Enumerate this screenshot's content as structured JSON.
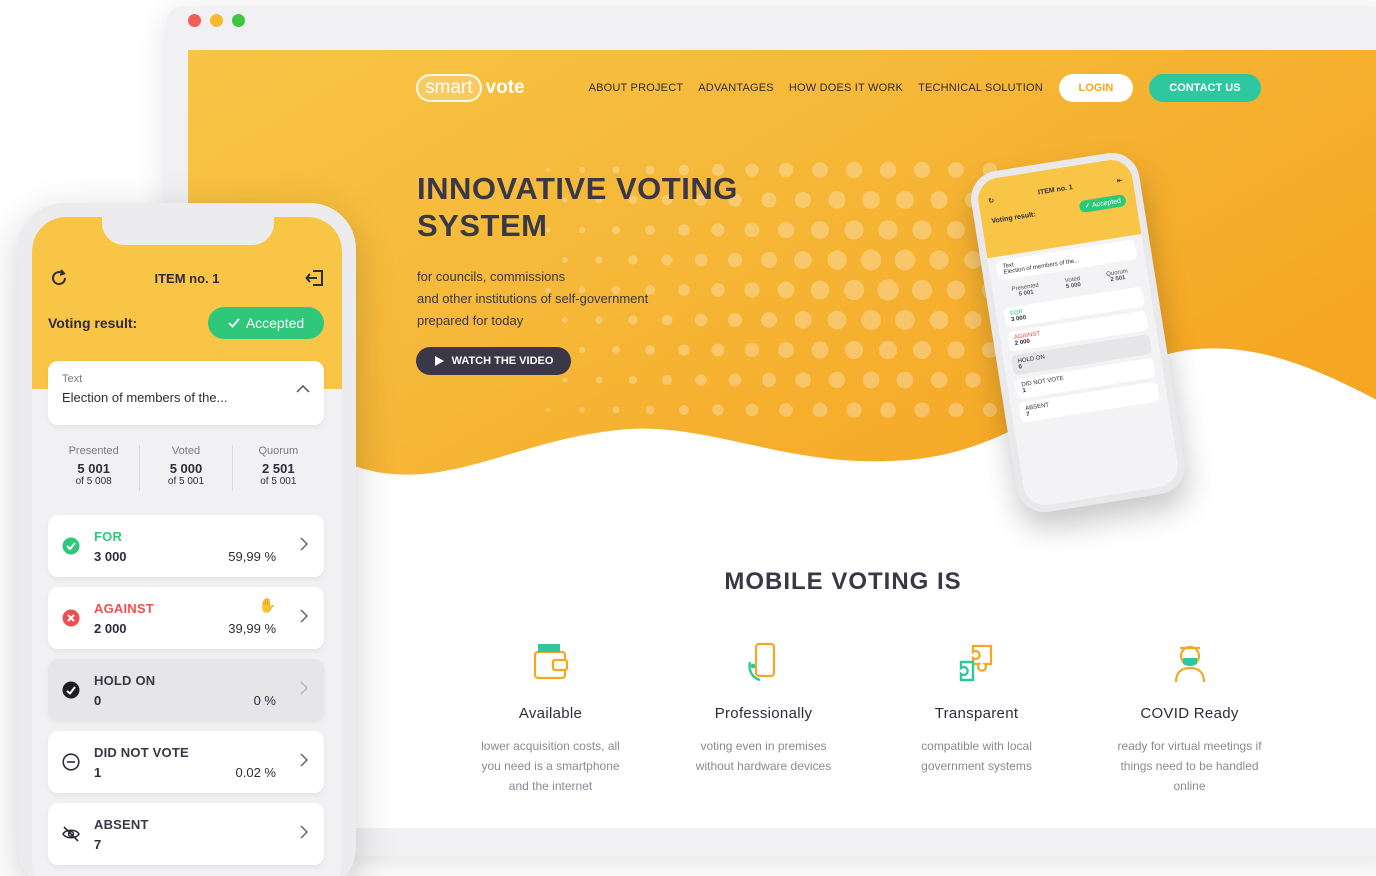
{
  "website": {
    "logo": {
      "part1": "smart",
      "part2": "vote"
    },
    "nav": [
      "ABOUT PROJECT",
      "ADVANTAGES",
      "HOW DOES IT WORK",
      "TECHNICAL SOLUTION"
    ],
    "login": "LOGIN",
    "contact": "CONTACT US",
    "hero": {
      "title": "INNOVATIVE VOTING SYSTEM",
      "subtitle": [
        "for councils, commissions",
        "and other institutions of self-government",
        "prepared for today"
      ],
      "video_button": "WATCH THE VIDEO"
    },
    "section_title": "MOBILE VOTING IS",
    "features": [
      {
        "title": "Available",
        "desc": "lower acquisition costs, all you need is a smartphone and the internet",
        "icon": "wallet-icon"
      },
      {
        "title": "Professionally",
        "desc": "voting even in premises without hardware devices",
        "icon": "phone-hand-icon"
      },
      {
        "title": "Transparent",
        "desc": "compatible with local government systems",
        "icon": "puzzle-icon"
      },
      {
        "title": "COVID Ready",
        "desc": "ready for virtual meetings if things need to be handled online",
        "icon": "masked-person-icon"
      }
    ],
    "colors": {
      "hero_yellow": "#f8c546",
      "hero_orange": "#f5a623",
      "accent_green": "#2fc7a0",
      "dark": "#3a3747"
    }
  },
  "phone": {
    "item_title": "ITEM no. 1",
    "voting_result_label": "Voting result:",
    "voting_result_value": "Accepted",
    "text_label": "Text",
    "text_value": "Election of members of the...",
    "stats": [
      {
        "label": "Presented",
        "value": "5 001",
        "of": "of 5 008"
      },
      {
        "label": "Voted",
        "value": "5 000",
        "of": "of 5 001"
      },
      {
        "label": "Quorum",
        "value": "2 501",
        "of": "of 5 001"
      }
    ],
    "votes": [
      {
        "label": "FOR",
        "count": "3 000",
        "pct": "59,99 %"
      },
      {
        "label": "AGAINST",
        "count": "2 000",
        "pct": "39,99 %"
      },
      {
        "label": "HOLD ON",
        "count": "0",
        "pct": "0 %"
      },
      {
        "label": "DID NOT VOTE",
        "count": "1",
        "pct": "0.02 %"
      },
      {
        "label": "ABSENT",
        "count": "7",
        "pct": ""
      }
    ]
  }
}
